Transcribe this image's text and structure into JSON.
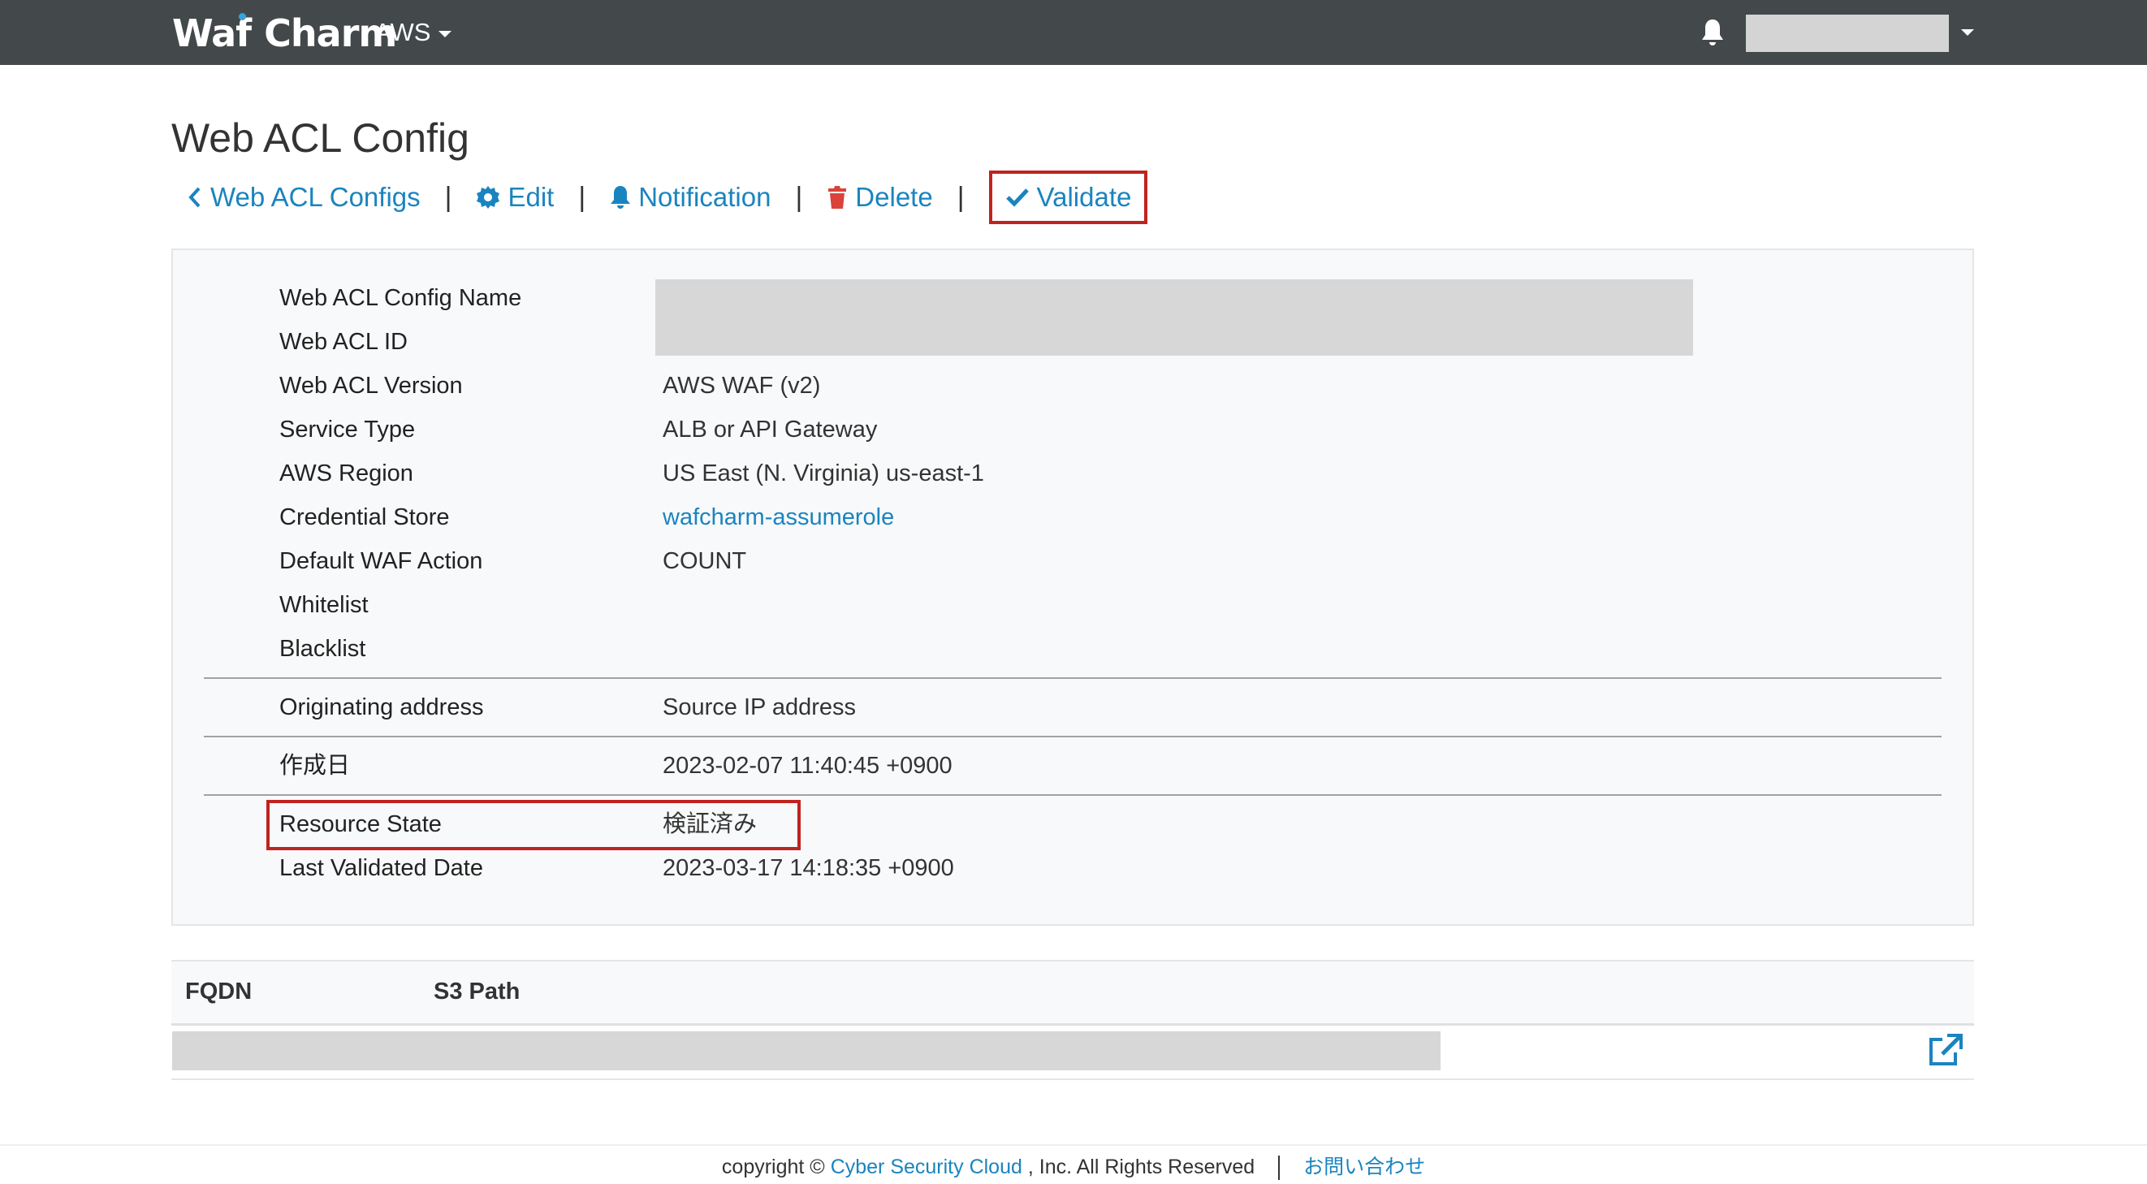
{
  "header": {
    "logo_part1": "Waf",
    "logo_part2": "Charm",
    "service_menu": "AWS",
    "bell_icon": "bell-icon",
    "user_menu_icon": "chevron-down-icon"
  },
  "page": {
    "title": "Web ACL Config"
  },
  "actions": {
    "back_label": "Web ACL Configs",
    "back_icon": "chevron-left-icon",
    "edit_label": "Edit",
    "edit_icon": "gear-icon",
    "notification_label": "Notification",
    "notification_icon": "bell-icon",
    "delete_label": "Delete",
    "delete_icon": "trash-icon",
    "validate_label": "Validate",
    "validate_icon": "check-icon",
    "separator": "|"
  },
  "details": {
    "config_name_label": "Web ACL Config Name",
    "acl_id_label": "Web ACL ID",
    "version_label": "Web ACL Version",
    "version_value": "AWS WAF (v2)",
    "service_type_label": "Service Type",
    "service_type_value": "ALB or API Gateway",
    "region_label": "AWS Region",
    "region_value": "US East (N. Virginia) us-east-1",
    "credential_label": "Credential Store",
    "credential_value": "wafcharm-assumerole",
    "default_action_label": "Default WAF Action",
    "default_action_value": "COUNT",
    "whitelist_label": "Whitelist",
    "blacklist_label": "Blacklist",
    "origin_label": "Originating address",
    "origin_value": "Source IP address",
    "created_label": "作成日",
    "created_value": "2023-02-07 11:40:45 +0900",
    "state_label": "Resource State",
    "state_value": "検証済み",
    "validated_label": "Last Validated Date",
    "validated_value": "2023-03-17 14:18:35 +0900"
  },
  "table": {
    "col_fqdn": "FQDN",
    "col_s3": "S3 Path",
    "open_icon": "external-link-icon"
  },
  "footer": {
    "copyright_prefix": "copyright ©",
    "company_link": "Cyber Security Cloud",
    "copyright_suffix": ", Inc. All Rights Reserved",
    "contact_link": "お問い合わせ"
  },
  "colors": {
    "navbar": "#43494b",
    "link": "#1a84bf",
    "highlight": "#c0231f",
    "danger": "#d9433a"
  }
}
